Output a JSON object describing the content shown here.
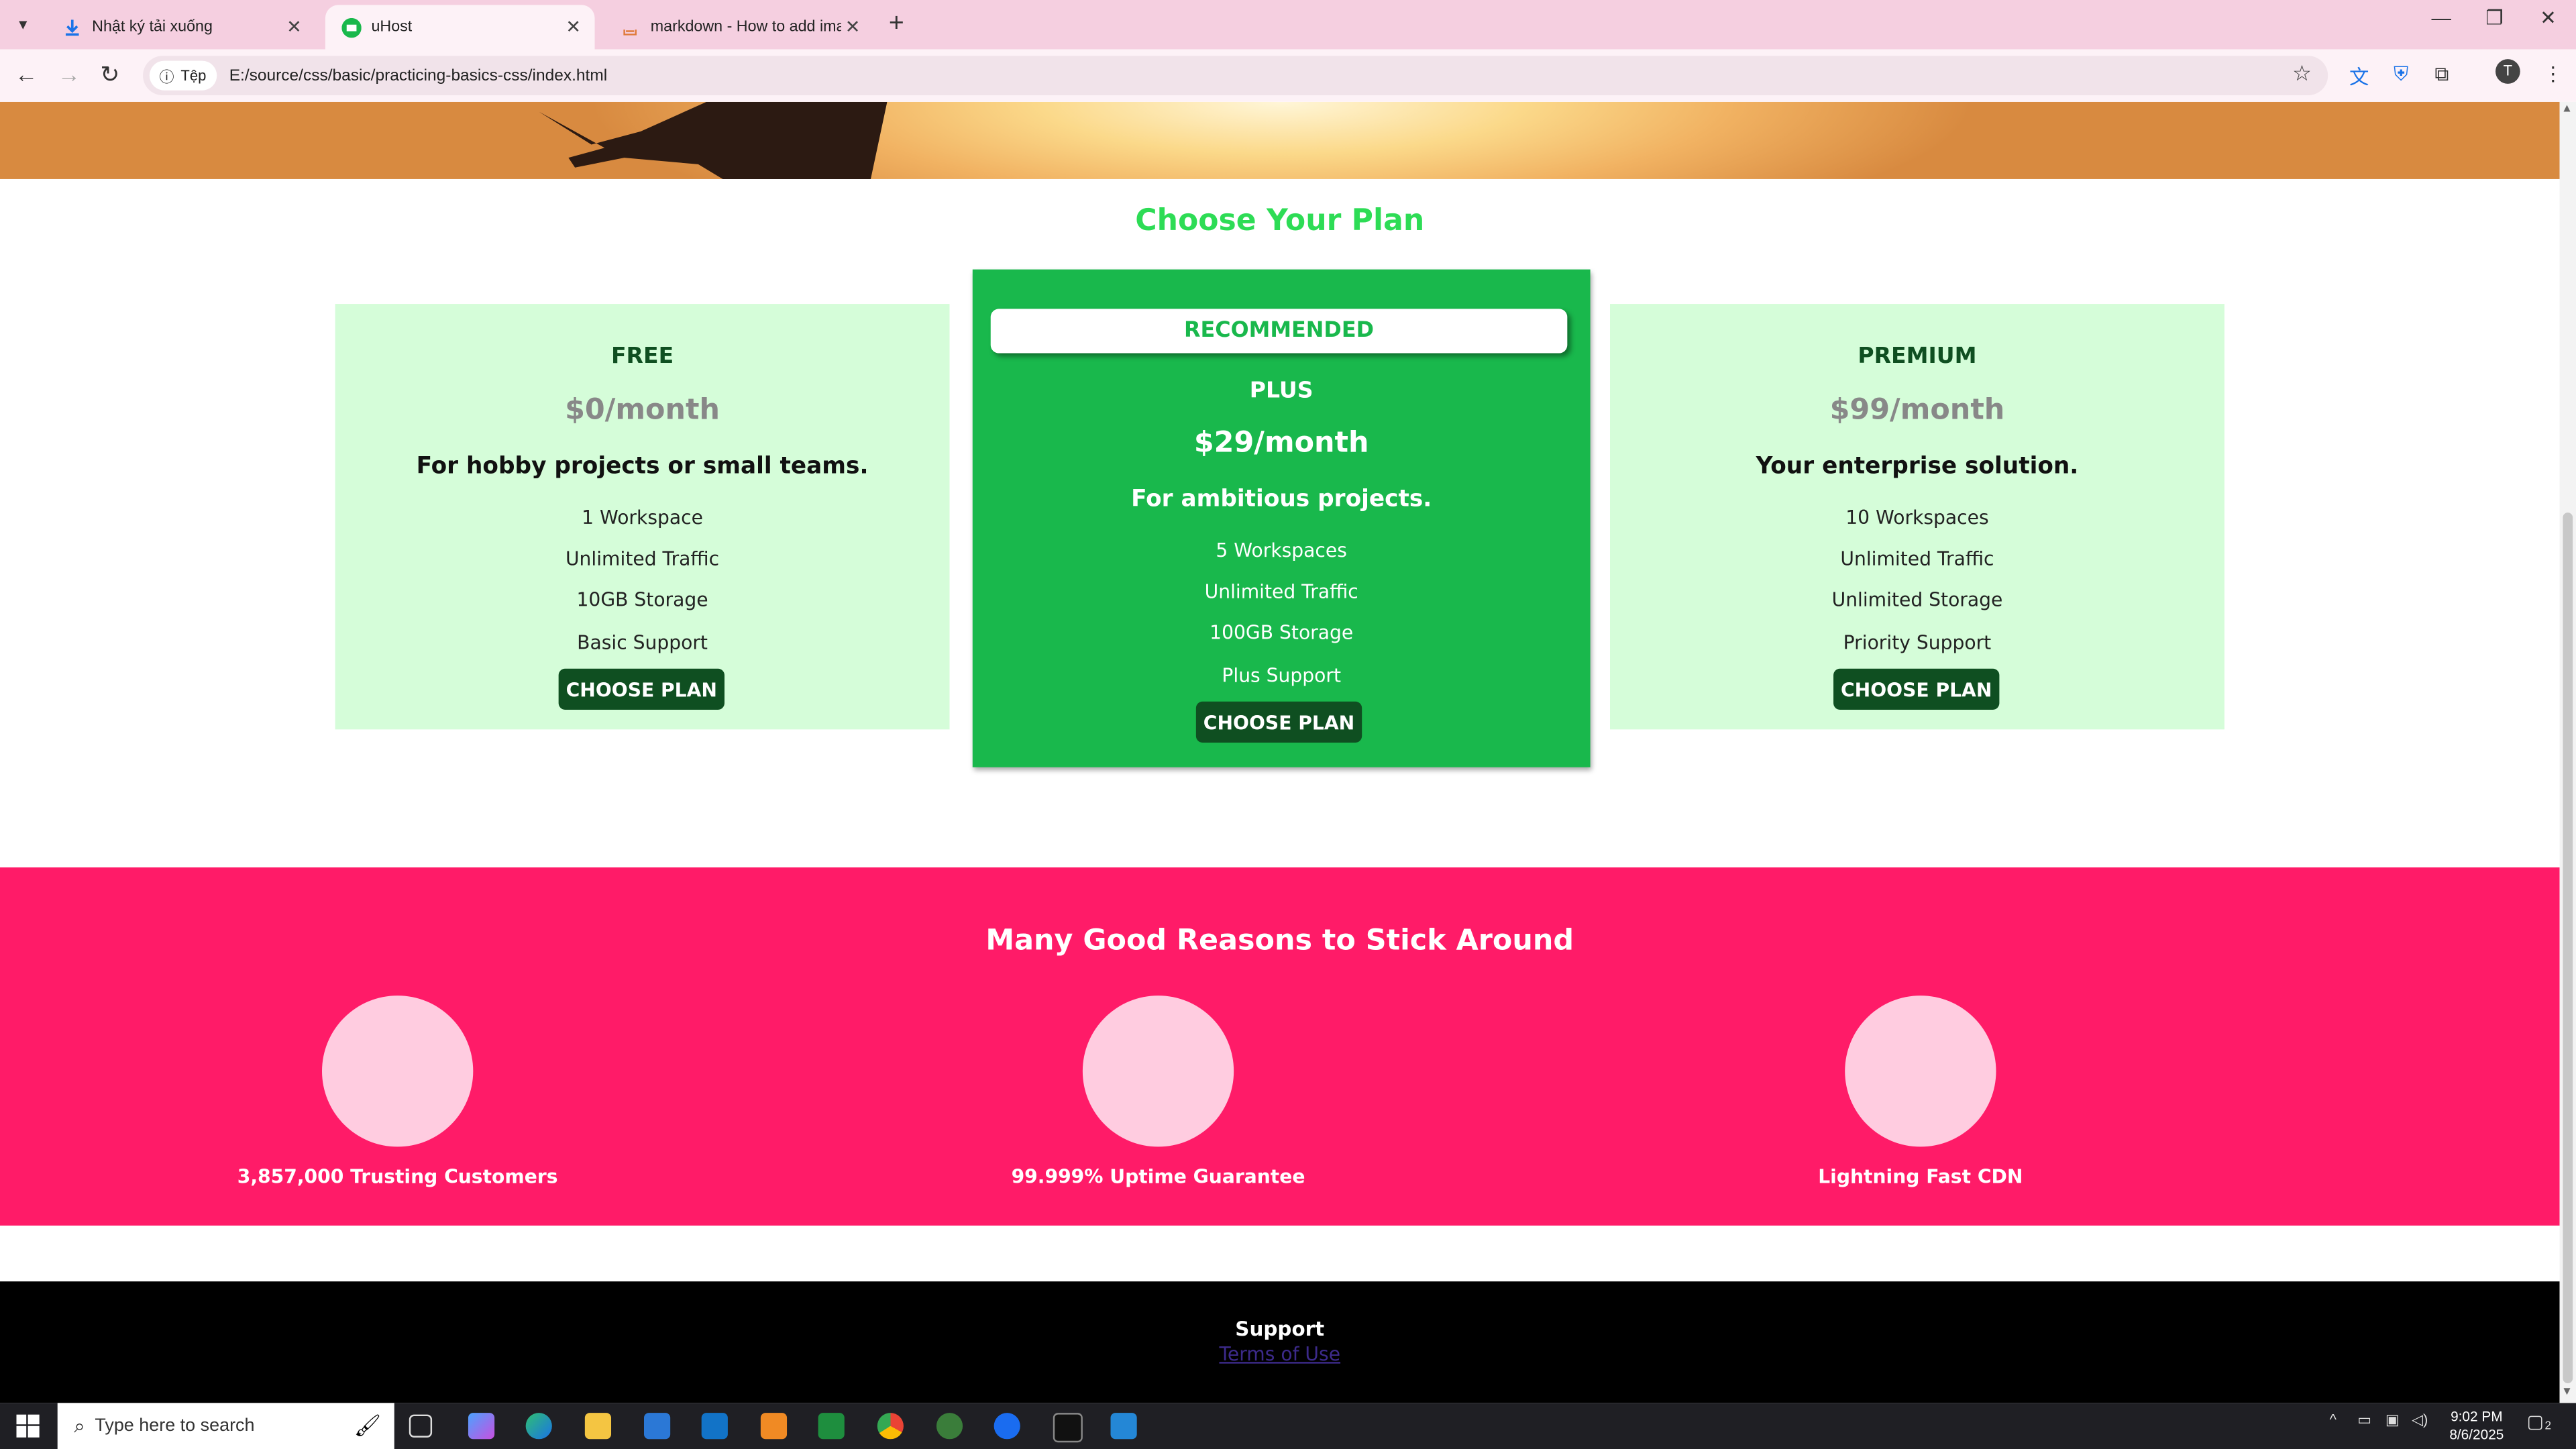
{
  "browser": {
    "tabs": [
      {
        "label": "Nhật ký tải xuống"
      },
      {
        "label": "uHost"
      },
      {
        "label": "markdown - How to add image"
      }
    ],
    "address_chip": "Tệp",
    "url": "E:/source/css/basic/practicing-basics-css/index.html"
  },
  "plans": {
    "title": "Choose Your Plan",
    "recommended": "RECOMMENDED",
    "items": [
      {
        "name": "FREE",
        "price": "$0/month",
        "desc": "For hobby projects or small teams.",
        "features": [
          "1 Workspace",
          "Unlimited Traffic",
          "10GB Storage",
          "Basic Support"
        ],
        "button": "CHOOSE PLAN"
      },
      {
        "name": "PLUS",
        "price": "$29/month",
        "desc": "For ambitious projects.",
        "features": [
          "5 Workspaces",
          "Unlimited Traffic",
          "100GB Storage",
          "Plus Support"
        ],
        "button": "CHOOSE PLAN"
      },
      {
        "name": "PREMIUM",
        "price": "$99/month",
        "desc": "Your enterprise solution.",
        "features": [
          "10 Workspaces",
          "Unlimited Traffic",
          "Unlimited Storage",
          "Priority Support"
        ],
        "button": "CHOOSE PLAN"
      }
    ]
  },
  "reasons": {
    "title": "Many Good Reasons to Stick Around",
    "items": [
      {
        "label": "3,857,000 Trusting Customers"
      },
      {
        "label": "99.999% Uptime Guarantee"
      },
      {
        "label": "Lightning Fast CDN"
      }
    ]
  },
  "footer": {
    "support": "Support",
    "terms": "Terms of Use"
  },
  "taskbar": {
    "search_placeholder": "Type here to search",
    "time": "9:02 PM",
    "date": "8/6/2025",
    "notification_count": "2"
  },
  "colors": {
    "plan_title": "#2ddc55",
    "card_bg": "#d5fdd9",
    "plus_bg": "#19b84c",
    "button": "#0f4f21",
    "reasons_bg": "#ff1b68",
    "circle": "#ffcce0"
  }
}
